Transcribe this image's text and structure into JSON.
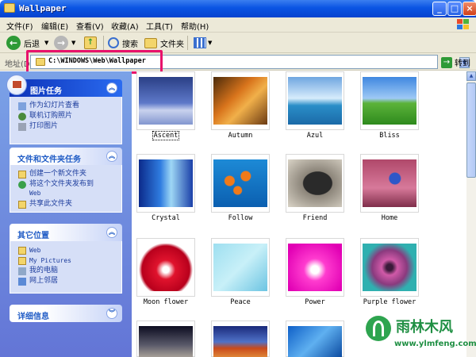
{
  "window": {
    "title": "Wallpaper"
  },
  "menu": [
    "文件(F)",
    "编辑(E)",
    "查看(V)",
    "收藏(A)",
    "工具(T)",
    "帮助(H)"
  ],
  "toolbar": {
    "back": "后退",
    "search": "搜索",
    "folders": "文件夹"
  },
  "address": {
    "label": "地址(D)",
    "value": "C:\\WINDOWS\\Web\\Wallpaper",
    "go": "转到"
  },
  "tasks": {
    "picture": {
      "title": "图片任务",
      "items": [
        "作为幻灯片查看",
        "联机订购照片",
        "打印图片"
      ]
    },
    "file": {
      "title": "文件和文件夹任务",
      "items": [
        "创建一个新文件夹",
        "将这个文件夹发布到",
        "Web",
        "共享此文件夹"
      ]
    },
    "other": {
      "title": "其它位置",
      "items": [
        "Web",
        "My Pictures",
        "我的电脑",
        "网上邻居"
      ]
    },
    "details": {
      "title": "详细信息"
    }
  },
  "thumbnails": [
    "Ascent",
    "Autumn",
    "Azul",
    "Bliss",
    "Crystal",
    "Follow",
    "Friend",
    "Home",
    "Moon flower",
    "Peace",
    "Power",
    "Purple flower"
  ],
  "watermark": {
    "brand": "雨林木风",
    "url": "www.ylmfeng.com"
  },
  "colors": {
    "highlight": "#e8126b",
    "titlebar": "#0a54e3"
  }
}
